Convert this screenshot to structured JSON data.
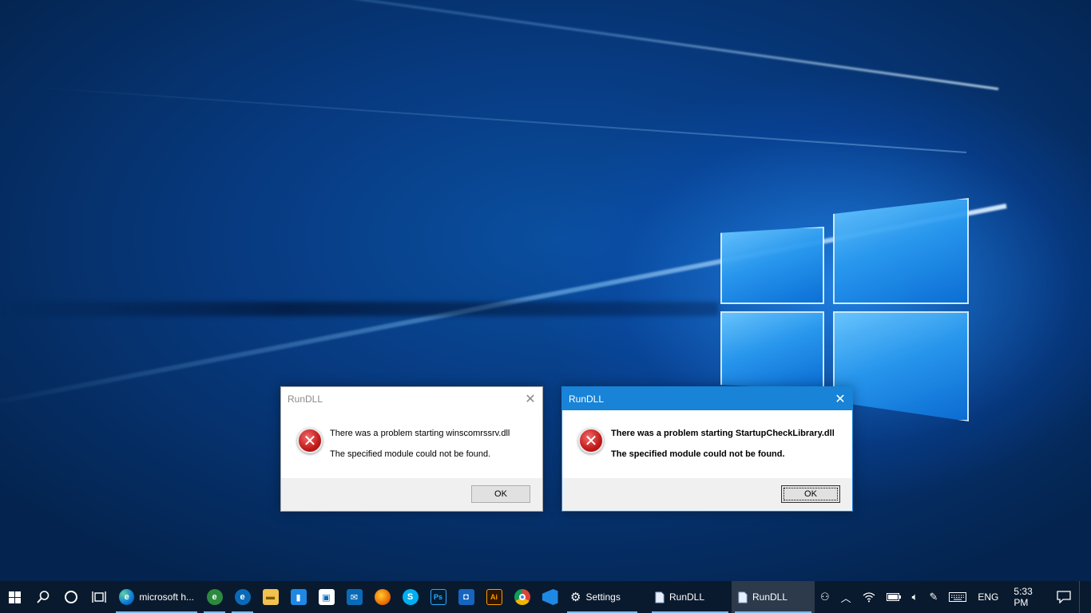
{
  "dialogs": [
    {
      "title": "RunDLL",
      "close_glyph": "✕",
      "icon": "error-icon",
      "line1": "There was a problem starting winscomrssrv.dll",
      "line2": "The specified module could not be found.",
      "ok_label": "OK",
      "state": "inactive"
    },
    {
      "title": "RunDLL",
      "close_glyph": "✕",
      "icon": "error-icon",
      "line1": "There was a problem starting StartupCheckLibrary.dll",
      "line2": "The specified module could not be found.",
      "ok_label": "OK",
      "state": "active"
    }
  ],
  "taskbar": {
    "start_icon": "windows-logo-icon",
    "search_icon": "search-icon",
    "cortana_icon": "cortana-circle-icon",
    "taskview_icon": "task-view-icon",
    "tasks": [
      {
        "icon": "edge-icon",
        "label": "microsoft h..."
      },
      {
        "icon": "settings-gear-icon",
        "label": "Settings"
      },
      {
        "icon": "document-icon",
        "label": "RunDLL"
      },
      {
        "icon": "document-icon",
        "label": "RunDLL"
      }
    ],
    "pinned": [
      {
        "icon": "edge-dev-icon",
        "glyph": "e",
        "color": "#2b8a3e"
      },
      {
        "icon": "edge-beta-icon",
        "glyph": "e",
        "color": "#0a6ab8"
      },
      {
        "icon": "file-explorer-icon",
        "glyph": "▬",
        "color": "#f2c14e"
      },
      {
        "icon": "app-blue-icon",
        "glyph": "▮",
        "color": "#1e88e5"
      },
      {
        "icon": "store-icon",
        "glyph": "▣",
        "color": "#0a0a0a"
      },
      {
        "icon": "mail-icon",
        "glyph": "✉",
        "color": "#0a6ab8"
      },
      {
        "icon": "firefox-icon",
        "glyph": "●",
        "color": "#e66000"
      },
      {
        "icon": "skype-icon",
        "glyph": "S",
        "color": "#00aff0"
      },
      {
        "icon": "photoshop-icon",
        "glyph": "Ps",
        "color": "#001d34"
      },
      {
        "icon": "camera-app-icon",
        "glyph": "◘",
        "color": "#1565c0"
      },
      {
        "icon": "illustrator-icon",
        "glyph": "Ai",
        "color": "#2e1600"
      },
      {
        "icon": "chrome-icon",
        "glyph": "◉",
        "color": "#db4437"
      },
      {
        "icon": "vscode-icon",
        "glyph": "◁",
        "color": "#1e88e5"
      }
    ],
    "tray": {
      "people_icon": "people-icon",
      "overflow_icon": "chevron-up-icon",
      "wifi_icon": "wifi-icon",
      "battery_icon": "battery-icon",
      "volume_icon": "volume-icon",
      "pen_icon": "pen-workspace-icon",
      "keyboard_icon": "touch-keyboard-icon",
      "language": "ENG",
      "time": "5:33 PM",
      "notification_icon": "action-center-icon"
    }
  }
}
